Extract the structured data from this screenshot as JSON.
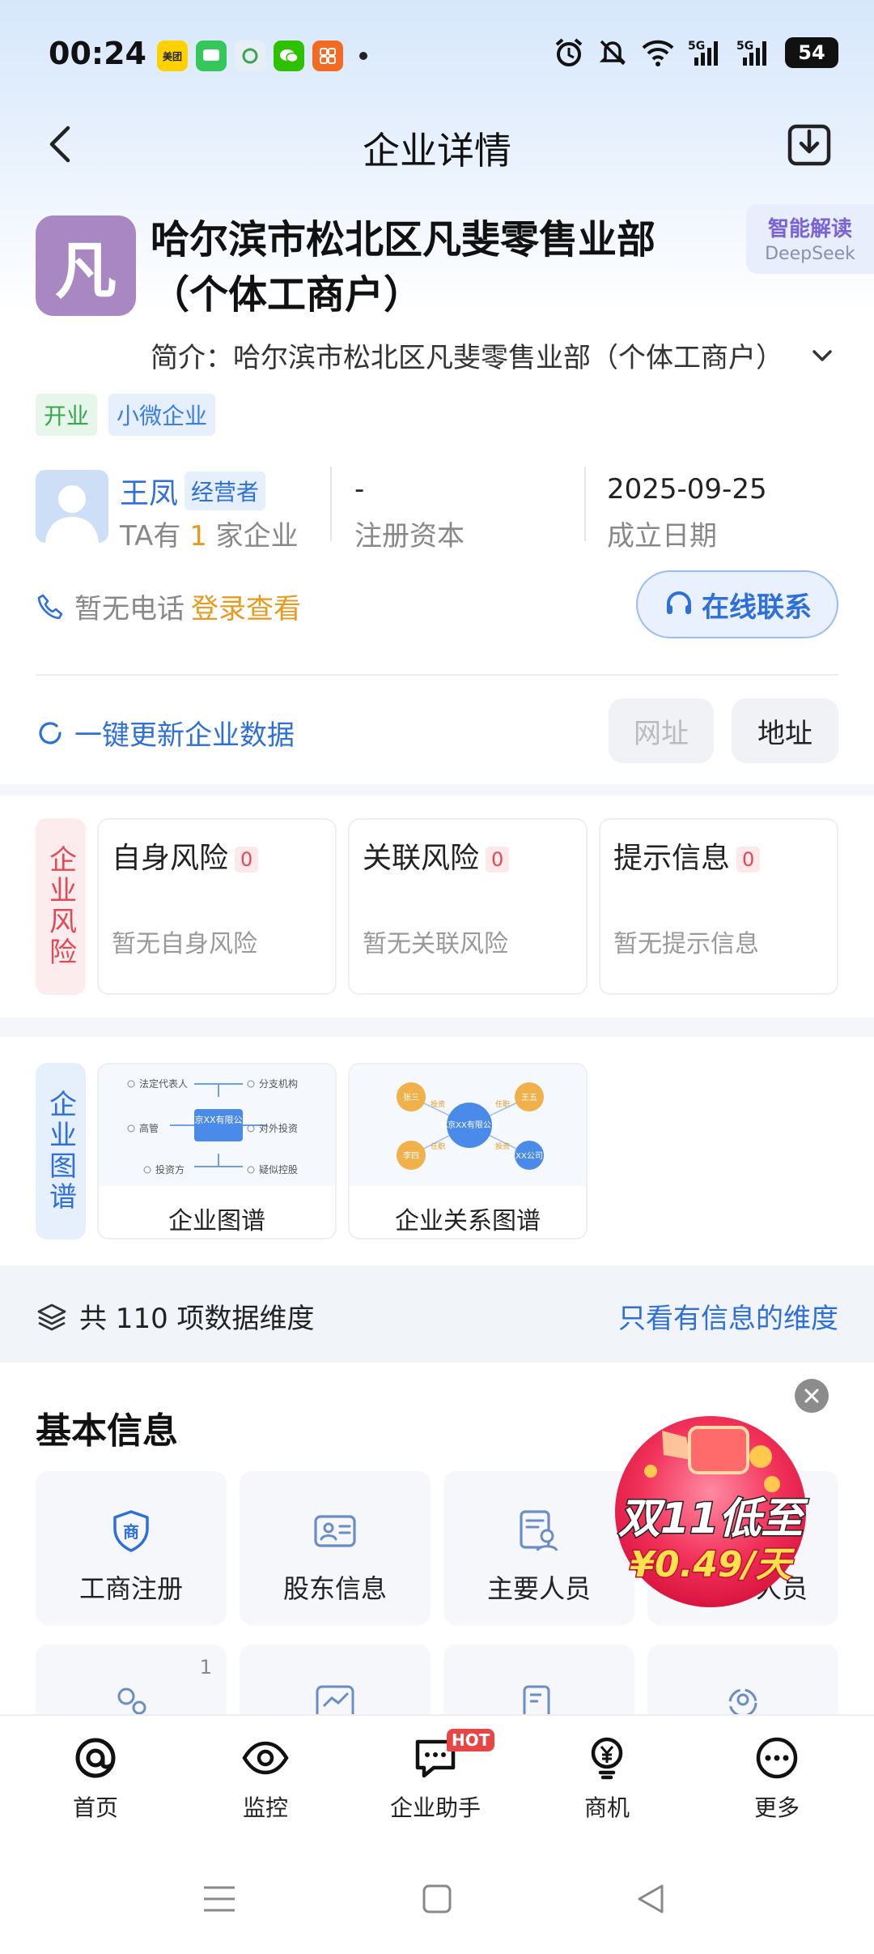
{
  "status_bar": {
    "time": "00:24",
    "app_icons": [
      {
        "name": "meituan-icon",
        "label": "美团",
        "color": "#ffd100",
        "text_color": "#222"
      },
      {
        "name": "messages-icon",
        "label": "",
        "color": "#34c759",
        "text_color": "#fff"
      },
      {
        "name": "app-icon",
        "label": "",
        "color": "#e8eef5",
        "text_color": "#333"
      },
      {
        "name": "wechat-icon",
        "label": "",
        "color": "#2dc100",
        "text_color": "#fff"
      },
      {
        "name": "app-orange-icon",
        "label": "",
        "color": "#f36a23",
        "text_color": "#fff"
      }
    ],
    "battery": "54"
  },
  "header": {
    "title": "企业详情"
  },
  "company": {
    "logo_char": "凡",
    "name": "哈尔滨市松北区凡斐零售业部（个体工商户）",
    "intro_label": "简介：",
    "intro": "哈尔滨市松北区凡斐零售业部（个体工商户）",
    "ai_badge_title": "智能解读",
    "ai_badge_sub": "DeepSeek",
    "tags": [
      "开业",
      "小微企业"
    ]
  },
  "info": {
    "person_name": "王凤",
    "role": "经营者",
    "person_sub_pre": "TA有 ",
    "person_sub_count": "1",
    "person_sub_post": " 家企业",
    "capital_value": "-",
    "capital_label": "注册资本",
    "date_value": "2025-09-25",
    "date_label": "成立日期"
  },
  "contact": {
    "phone_text": "暂无电话",
    "login_link": "登录查看",
    "online_button": "在线联系"
  },
  "update": {
    "label": "一键更新企业数据",
    "website_button": "网址",
    "address_button": "地址"
  },
  "risk": {
    "side_label": "企业风险",
    "cards": [
      {
        "title": "自身风险",
        "count": "0",
        "empty": "暂无自身风险"
      },
      {
        "title": "关联风险",
        "count": "0",
        "empty": "暂无关联风险"
      },
      {
        "title": "提示信息",
        "count": "0",
        "empty": "暂无提示信息"
      }
    ]
  },
  "graph": {
    "side_label": "企业图谱",
    "cards": [
      {
        "label": "企业图谱",
        "center": "北京XX有限公司",
        "nodes": [
          "法定代表人",
          "分支机构",
          "高管",
          "对外投资",
          "投资方",
          "疑似控股"
        ]
      },
      {
        "label": "企业关系图谱",
        "center": "北京XX有限公司",
        "nodes": [
          "张三",
          "王五",
          "李四",
          "XX公司"
        ],
        "edges": [
          "投资",
          "任职",
          "任职",
          "投资"
        ]
      }
    ]
  },
  "dimensions": {
    "text": "共 110 项数据维度",
    "filter_link": "只看有信息的维度"
  },
  "basic_info": {
    "title": "基本信息",
    "cards": [
      {
        "label": "工商注册",
        "icon": "shop-shield-icon"
      },
      {
        "label": "股东信息",
        "icon": "id-card-icon"
      },
      {
        "label": "主要人员",
        "icon": "person-doc-icon"
      },
      {
        "label": "人员",
        "icon": "people-icon"
      }
    ],
    "second_row_badge": "1"
  },
  "promo": {
    "line1": "双11低至",
    "line2": "¥0.49/天"
  },
  "bottom_nav": {
    "items": [
      {
        "label": "首页",
        "icon": "home-at-icon"
      },
      {
        "label": "监控",
        "icon": "eye-icon"
      },
      {
        "label": "企业助手",
        "icon": "chat-icon",
        "badge": "HOT"
      },
      {
        "label": "商机",
        "icon": "yen-bulb-icon"
      },
      {
        "label": "更多",
        "icon": "more-icon"
      }
    ]
  },
  "colors": {
    "accent": "#2f6fd8",
    "warning": "#e59a20",
    "danger": "#e04a55",
    "logo": "#a887c3"
  }
}
